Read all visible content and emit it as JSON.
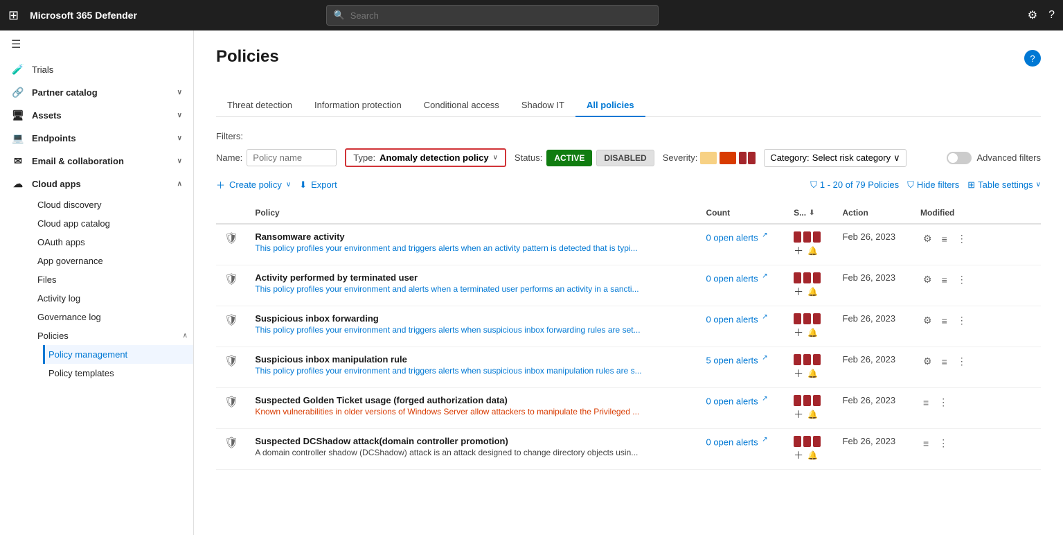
{
  "app": {
    "title": "Microsoft 365 Defender",
    "waffle_icon": "⊞"
  },
  "search": {
    "placeholder": "Search"
  },
  "top_nav_icons": {
    "settings": "⚙",
    "help": "?"
  },
  "sidebar": {
    "hamburger": "☰",
    "items": [
      {
        "id": "trials",
        "label": "Trials",
        "icon": "🧪",
        "expandable": false
      },
      {
        "id": "partner-catalog",
        "label": "Partner catalog",
        "icon": "🔗",
        "expandable": true
      },
      {
        "id": "assets",
        "label": "Assets",
        "icon": "🖥",
        "expandable": true
      },
      {
        "id": "endpoints",
        "label": "Endpoints",
        "icon": "💻",
        "expandable": true
      },
      {
        "id": "email-collab",
        "label": "Email & collaboration",
        "icon": "✉",
        "expandable": true
      },
      {
        "id": "cloud-apps",
        "label": "Cloud apps",
        "icon": "☁",
        "expandable": true,
        "expanded": true
      }
    ],
    "cloud_apps_children": [
      {
        "id": "cloud-discovery",
        "label": "Cloud discovery",
        "icon": "🔍"
      },
      {
        "id": "cloud-app-catalog",
        "label": "Cloud app catalog",
        "icon": "📋"
      },
      {
        "id": "oauth-apps",
        "label": "OAuth apps",
        "icon": "🔐"
      },
      {
        "id": "app-governance",
        "label": "App governance",
        "icon": "🛡"
      },
      {
        "id": "files",
        "label": "Files",
        "icon": "📄"
      },
      {
        "id": "activity-log",
        "label": "Activity log",
        "icon": "📊"
      },
      {
        "id": "governance-log",
        "label": "Governance log",
        "icon": "📝"
      },
      {
        "id": "policies",
        "label": "Policies",
        "icon": "📌",
        "active": true,
        "expandable": true,
        "expanded": true
      }
    ],
    "policies_children": [
      {
        "id": "policy-management",
        "label": "Policy management",
        "active": true
      },
      {
        "id": "policy-templates",
        "label": "Policy templates"
      }
    ]
  },
  "page": {
    "title": "Policies",
    "help_icon": "?"
  },
  "tabs": [
    {
      "id": "threat-detection",
      "label": "Threat detection"
    },
    {
      "id": "information-protection",
      "label": "Information protection"
    },
    {
      "id": "conditional-access",
      "label": "Conditional access"
    },
    {
      "id": "shadow-it",
      "label": "Shadow IT"
    },
    {
      "id": "all-policies",
      "label": "All policies",
      "active": true
    }
  ],
  "filters": {
    "label": "Filters:",
    "name_label": "Name:",
    "name_placeholder": "Policy name",
    "type_label": "Type:",
    "type_value": "Anomaly detection policy",
    "status_label": "Status:",
    "status_active": "ACTIVE",
    "status_disabled": "DISABLED",
    "severity_label": "Severity:",
    "category_label": "Category:",
    "category_value": "Select risk category",
    "advanced_label": "Advanced filters"
  },
  "toolbar": {
    "create_label": "Create policy",
    "export_label": "Export",
    "policy_count": "1 - 20 of 79 Policies",
    "hide_filters_label": "Hide filters",
    "table_settings_label": "Table settings"
  },
  "table": {
    "headers": [
      {
        "id": "policy",
        "label": "Policy"
      },
      {
        "id": "count",
        "label": "Count"
      },
      {
        "id": "severity",
        "label": "S...",
        "sortable": true
      },
      {
        "id": "action",
        "label": "Action"
      },
      {
        "id": "modified",
        "label": "Modified"
      }
    ],
    "rows": [
      {
        "icon": "🛡",
        "name": "Ransomware activity",
        "desc": "This policy profiles your environment and triggers alerts when an activity pattern is detected that is typi...",
        "desc_color": "blue",
        "count": "0 open alerts",
        "date": "Feb 26, 2023",
        "has_settings": true,
        "has_list": true,
        "has_more": true
      },
      {
        "icon": "🛡",
        "name": "Activity performed by terminated user",
        "desc": "This policy profiles your environment and alerts when a terminated user performs an activity in a sancti...",
        "desc_color": "blue",
        "count": "0 open alerts",
        "date": "Feb 26, 2023",
        "has_settings": true,
        "has_list": true,
        "has_more": true
      },
      {
        "icon": "🛡",
        "name": "Suspicious inbox forwarding",
        "desc": "This policy profiles your environment and triggers alerts when suspicious inbox forwarding rules are set...",
        "desc_color": "blue",
        "count": "0 open alerts",
        "date": "Feb 26, 2023",
        "has_settings": true,
        "has_list": true,
        "has_more": true
      },
      {
        "icon": "🛡",
        "name": "Suspicious inbox manipulation rule",
        "desc": "This policy profiles your environment and triggers alerts when suspicious inbox manipulation rules are s...",
        "desc_color": "blue",
        "count": "5 open alerts",
        "date": "Feb 26, 2023",
        "has_settings": true,
        "has_list": true,
        "has_more": true
      },
      {
        "icon": "🛡",
        "name": "Suspected Golden Ticket usage (forged authorization data)",
        "desc": "Known vulnerabilities in older versions of Windows Server allow attackers to manipulate the Privileged ...",
        "desc_color": "orange",
        "count": "0 open alerts",
        "date": "Feb 26, 2023",
        "has_settings": false,
        "has_list": true,
        "has_more": true
      },
      {
        "icon": "🛡",
        "name": "Suspected DCShadow attack(domain controller promotion)",
        "desc": "A domain controller shadow (DCShadow) attack is an attack designed to change directory objects usin...",
        "desc_color": "dark",
        "count": "0 open alerts",
        "date": "Feb 26, 2023",
        "has_settings": false,
        "has_list": true,
        "has_more": true
      }
    ]
  }
}
